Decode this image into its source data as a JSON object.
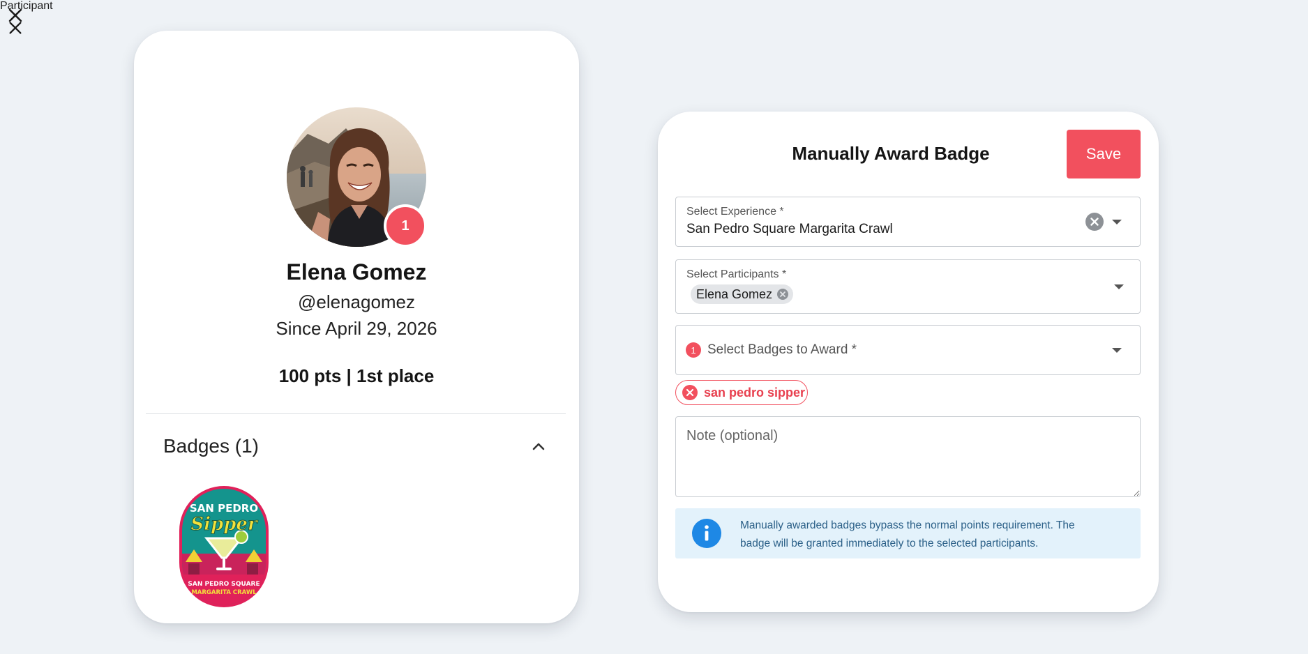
{
  "participant_card": {
    "title": "Participant",
    "avatar_badge_count": "1",
    "name": "Elena Gomez",
    "handle": "@elenagomez",
    "since": "Since April 29, 2026",
    "stats": "100 pts | 1st place",
    "badges_header": "Badges (1)",
    "badges": [
      {
        "top_text": "SAN PEDRO",
        "script_text": "Sipper",
        "bottom_text_1": "SAN PEDRO SQUARE",
        "bottom_text_2": "MARGARITA CRAWL"
      }
    ]
  },
  "award_card": {
    "title": "Manually Award Badge",
    "save_label": "Save",
    "experience": {
      "label": "Select Experience *",
      "value": "San Pedro Square Margarita Crawl"
    },
    "participants": {
      "label": "Select Participants *",
      "chips": [
        "Elena Gomez"
      ]
    },
    "badges": {
      "count": "1",
      "placeholder": "Select Badges to Award *",
      "selected": [
        "san pedro sipper"
      ]
    },
    "note": {
      "placeholder": "Note (optional)",
      "value": ""
    },
    "info": {
      "line1": "Manually awarded badges bypass the normal points requirement. The",
      "line2": "badge will be granted immediately to the selected participants."
    }
  },
  "colors": {
    "accent": "#f2505e",
    "info_background": "#e3f2fb",
    "info_text": "#2a5f87",
    "info_icon": "#1e88e5",
    "page_background": "#eef2f6"
  },
  "icons": {
    "close": "close-icon",
    "chevron": "chevron-up-icon",
    "clear": "clear-circle-icon",
    "info": "info-icon",
    "dropdown": "dropdown-caret-icon"
  }
}
